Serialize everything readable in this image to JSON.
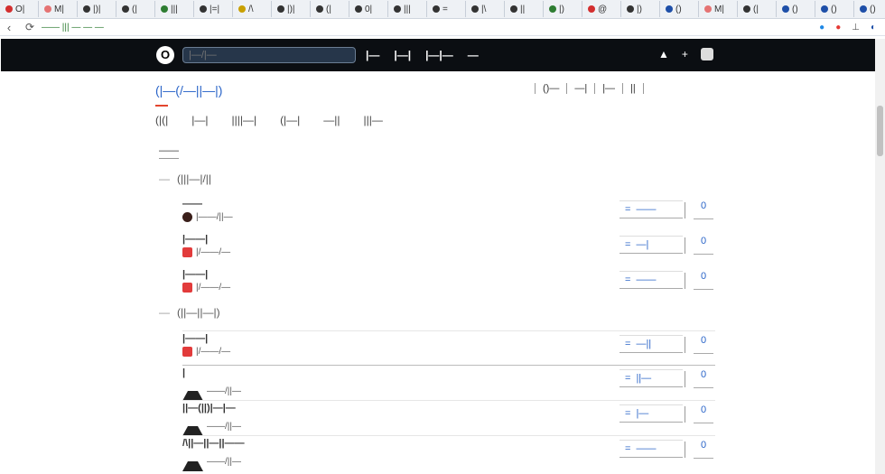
{
  "browser": {
    "tabs": [
      {
        "label": "O|",
        "color": "#d32f2f"
      },
      {
        "label": "M|",
        "color": "#e57373"
      },
      {
        "label": "|)|",
        "color": "#333333"
      },
      {
        "label": "(|",
        "color": "#333333"
      },
      {
        "label": "|||",
        "color": "#2e7d32"
      },
      {
        "label": "|=|",
        "color": "#333333"
      },
      {
        "label": "/\\",
        "color": "#c9a000"
      },
      {
        "label": "|)|",
        "color": "#333333"
      },
      {
        "label": "(|",
        "color": "#333333"
      },
      {
        "label": "0|",
        "color": "#333333"
      },
      {
        "label": "|||",
        "color": "#333333"
      },
      {
        "label": "=",
        "color": "#333333"
      },
      {
        "label": "|\\",
        "color": "#333333"
      },
      {
        "label": "||",
        "color": "#333333"
      },
      {
        "label": "|)",
        "color": "#2e7d32"
      },
      {
        "label": "@",
        "color": "#d32f2f"
      },
      {
        "label": "|)",
        "color": "#333333"
      },
      {
        "label": "()",
        "color": "#1e4fa8"
      },
      {
        "label": "M|",
        "color": "#e57373"
      },
      {
        "label": "(|",
        "color": "#333333"
      },
      {
        "label": "()",
        "color": "#1e4fa8"
      },
      {
        "label": "()",
        "color": "#1e4fa8"
      },
      {
        "label": "()",
        "color": "#1e4fa8"
      },
      {
        "label": "=",
        "color": "#333333"
      },
      {
        "label": "(|",
        "color": "#333333"
      }
    ],
    "window_controls": [
      "—",
      "_",
      "×"
    ],
    "url": "—— ||| — — —",
    "back_icon": "‹",
    "reload_icon": "⟳"
  },
  "site": {
    "logo": "O",
    "search_placeholder": "|—/|—",
    "nav": [
      "|—",
      "|—|",
      "|—|—",
      "—"
    ],
    "header_right": [
      "▲",
      "+",
      "▣"
    ]
  },
  "repo": {
    "title": "(|—(/—||—|)",
    "actions": [
      "()—",
      "—|",
      "|—",
      "||"
    ],
    "tabs": [
      "(|(|",
      "|—|",
      "||||—|",
      "(|—|",
      "—||",
      "|||—"
    ],
    "active_tab_index": 0,
    "branch_label": "——"
  },
  "sections": [
    {
      "label": "(|||—|/||",
      "rows": [
        {
          "title": "——",
          "meta": "|——/||—",
          "avatar": "dot",
          "action": "——",
          "index": "0"
        },
        {
          "title": "|——|",
          "meta": "|/——/—",
          "avatar": "red",
          "action": "—|",
          "index": "0"
        },
        {
          "title": "|——|",
          "meta": "|/——/—",
          "avatar": "red",
          "action": "——",
          "index": "0"
        }
      ]
    },
    {
      "label": "(||—||—|)",
      "rows": [
        {
          "title": "|——|",
          "meta": "|/——/—",
          "avatar": "red",
          "action": "—||",
          "index": "0"
        },
        {
          "title": "|",
          "meta": "——/||—",
          "avatar": "tri",
          "action": "||—",
          "index": "0"
        },
        {
          "title": "||—(||)|—|—",
          "meta": "——/||—",
          "avatar": "tri",
          "action": "|—",
          "index": "0"
        },
        {
          "title": "/\\||—||—||——",
          "meta": "——/||—",
          "avatar": "tri",
          "action": "——",
          "index": "0"
        }
      ]
    }
  ],
  "colors": {
    "header_bg": "#0b0e12",
    "link_blue": "#2a64c8",
    "active_tab_underline": "#e3452e"
  }
}
